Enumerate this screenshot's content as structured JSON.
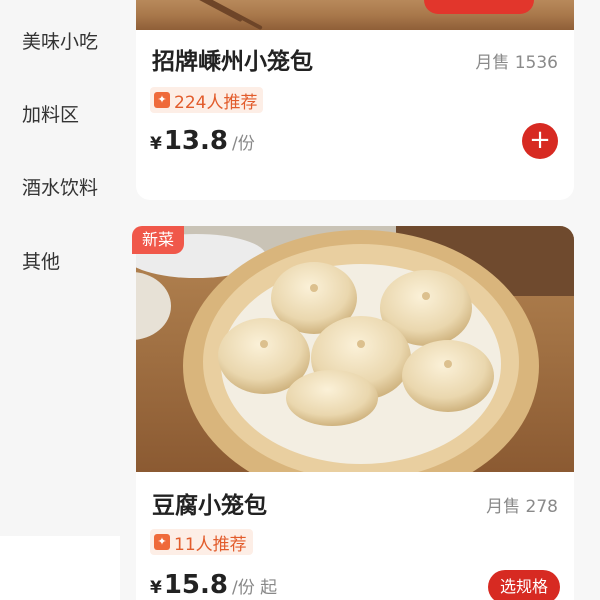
{
  "sidebar": {
    "items": [
      {
        "label": "美味小吃"
      },
      {
        "label": "加料区"
      },
      {
        "label": "酒水饮料"
      },
      {
        "label": "其他"
      }
    ]
  },
  "products": [
    {
      "title": "招牌嵊州小笼包",
      "sales": "月售 1536",
      "badge": "224人推荐",
      "currency": "¥",
      "price": "13.8",
      "unit": "/份",
      "action": "+"
    },
    {
      "new_tag": "新菜",
      "title": "豆腐小笼包",
      "sales": "月售 278",
      "badge": "11人推荐",
      "currency": "¥",
      "price": "15.8",
      "unit": "/份 起",
      "action": "选规格"
    }
  ],
  "colors": {
    "accent": "#d72a22",
    "badge_text": "#e25c2c",
    "badge_bg": "#fdeee6",
    "new_tag": "#f0584a"
  }
}
